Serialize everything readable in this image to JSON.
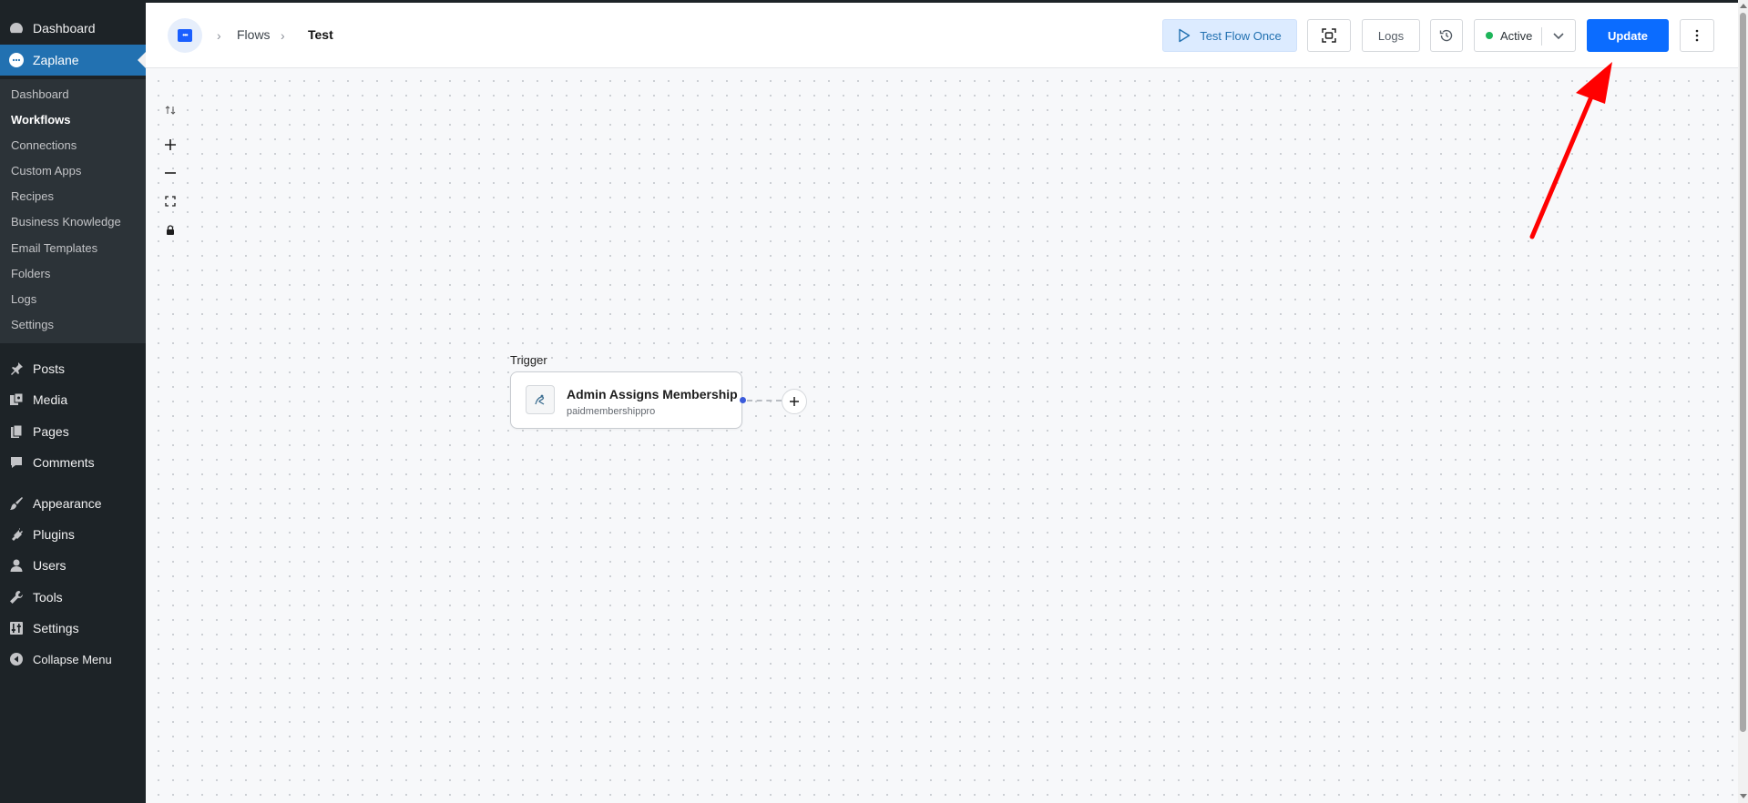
{
  "wp_menu": {
    "dashboard": "Dashboard",
    "zaplane": "Zaplane",
    "submenu": [
      "Dashboard",
      "Workflows",
      "Connections",
      "Custom Apps",
      "Recipes",
      "Business Knowledge",
      "Email Templates",
      "Folders",
      "Logs",
      "Settings"
    ],
    "active_sub": "Workflows",
    "posts": "Posts",
    "media": "Media",
    "pages": "Pages",
    "comments": "Comments",
    "appearance": "Appearance",
    "plugins": "Plugins",
    "users": "Users",
    "tools": "Tools",
    "settings": "Settings",
    "collapse": "Collapse Menu"
  },
  "breadcrumb": {
    "flows": "Flows",
    "current": "Test"
  },
  "toolbar": {
    "test_flow_label": "Test Flow Once",
    "logs_label": "Logs",
    "status_label": "Active",
    "update_label": "Update"
  },
  "flow": {
    "trigger_heading": "Trigger",
    "node_title": "Admin Assigns Membership",
    "node_app": "paidmembershippro"
  },
  "colors": {
    "wp_sidebar": "#1d2327",
    "wp_highlight": "#2271b1",
    "update_button": "#0b6cff",
    "status_dot": "#1eb55a",
    "annotation_arrow": "#ff0000"
  }
}
